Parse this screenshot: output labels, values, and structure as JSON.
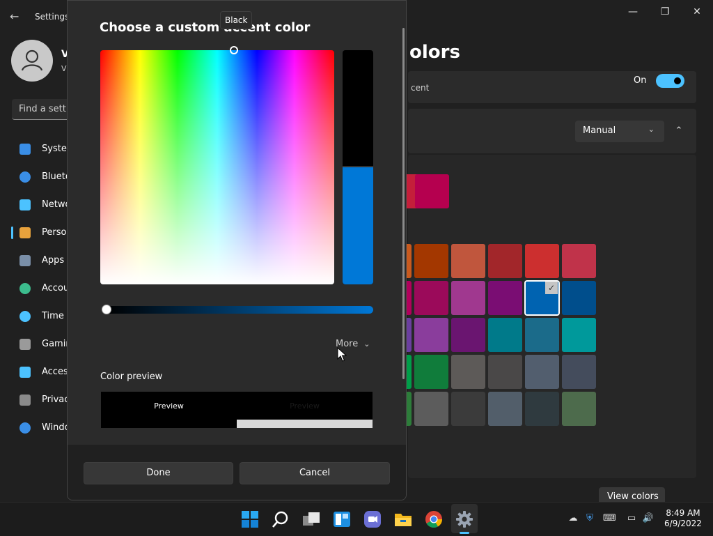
{
  "window": {
    "title": "Settings",
    "back_icon": "back-arrow-icon",
    "minimize_icon": "minimize-icon",
    "restore_icon": "restore-icon",
    "close_icon": "close-icon"
  },
  "user": {
    "name_initial": "V",
    "sub_initial": "V"
  },
  "search": {
    "placeholder": "Find a setti"
  },
  "sidebar": {
    "items": [
      {
        "label": "Syster",
        "icon": "system-icon",
        "color": "#3a8ee6"
      },
      {
        "label": "Blueto",
        "icon": "bluetooth-icon",
        "color": "#3a8ee6"
      },
      {
        "label": "Netwo",
        "icon": "network-icon",
        "color": "#4cc2ff"
      },
      {
        "label": "Perso",
        "icon": "personalization-brush-icon",
        "color": "#e8a23c"
      },
      {
        "label": "Apps",
        "icon": "apps-icon",
        "color": "#7a8fa8"
      },
      {
        "label": "Accou",
        "icon": "accounts-icon",
        "color": "#3cbc8d"
      },
      {
        "label": "Time",
        "icon": "time-language-icon",
        "color": "#4cc2ff"
      },
      {
        "label": "Gamin",
        "icon": "gaming-icon",
        "color": "#9a9a9a"
      },
      {
        "label": "Acces",
        "icon": "accessibility-icon",
        "color": "#4cc2ff"
      },
      {
        "label": "Privac",
        "icon": "privacy-shield-icon",
        "color": "#8a8a8a"
      },
      {
        "label": "Windo",
        "icon": "windows-update-icon",
        "color": "#3a8ee6"
      }
    ]
  },
  "colors_page": {
    "heading_partial": "olors",
    "accent_partial": "cent",
    "toggle_label": "On",
    "accent_mode": "Manual",
    "view_colors_label": "View colors",
    "recent_swatches": [
      "#c41f3a",
      "#b5004f"
    ],
    "swatch_rows": [
      [
        "#c95a1e",
        "#a33700",
        "#c0563d",
        "#a2262a",
        "#cc2f2f",
        "#c0334a"
      ],
      [
        "#b2005c",
        "#9b0a5a",
        "#a0388f",
        "#7a0d73",
        "#0063b1",
        "#004e8c"
      ],
      [
        "#6b3fa0",
        "#8a3d9c",
        "#6a1570",
        "#007a8a",
        "#1b6b8a",
        "#00999b"
      ],
      [
        "#009e49",
        "#107c3b",
        "#5d5a58",
        "#4a4848",
        "#525e6e",
        "#444c5c"
      ],
      [
        "#2d7d3a",
        "#5c5c5c",
        "#3b3b3b",
        "#525e6a",
        "#2f3a3f",
        "#4d6b4c"
      ]
    ],
    "selected_swatch": "#0063b1"
  },
  "dialog": {
    "title": "Choose a custom accent color",
    "tooltip": "Black",
    "more_label": "More",
    "preview_label": "Color preview",
    "preview_left_text": "Preview",
    "preview_right_text": "Preview",
    "done_label": "Done",
    "cancel_label": "Cancel",
    "value_fill_fraction": 0.5,
    "slider_fraction": 0.0,
    "current_color": "#000000",
    "accent_color": "#0078d7"
  },
  "taskbar": {
    "icons": [
      {
        "name": "start-icon"
      },
      {
        "name": "search-icon"
      },
      {
        "name": "task-view-icon"
      },
      {
        "name": "widgets-icon"
      },
      {
        "name": "teams-chat-icon"
      },
      {
        "name": "file-explorer-icon"
      },
      {
        "name": "chrome-icon"
      },
      {
        "name": "settings-gear-icon"
      }
    ],
    "tray": [
      {
        "name": "onedrive-icon",
        "glyph": "☁"
      },
      {
        "name": "security-warning-icon",
        "glyph": "⛨"
      },
      {
        "name": "keyboard-icon",
        "glyph": "⌨"
      },
      {
        "name": "network-icon",
        "glyph": "▭"
      },
      {
        "name": "volume-icon",
        "glyph": "🔊"
      }
    ],
    "time": "8:49 AM",
    "date": "6/9/2022"
  }
}
